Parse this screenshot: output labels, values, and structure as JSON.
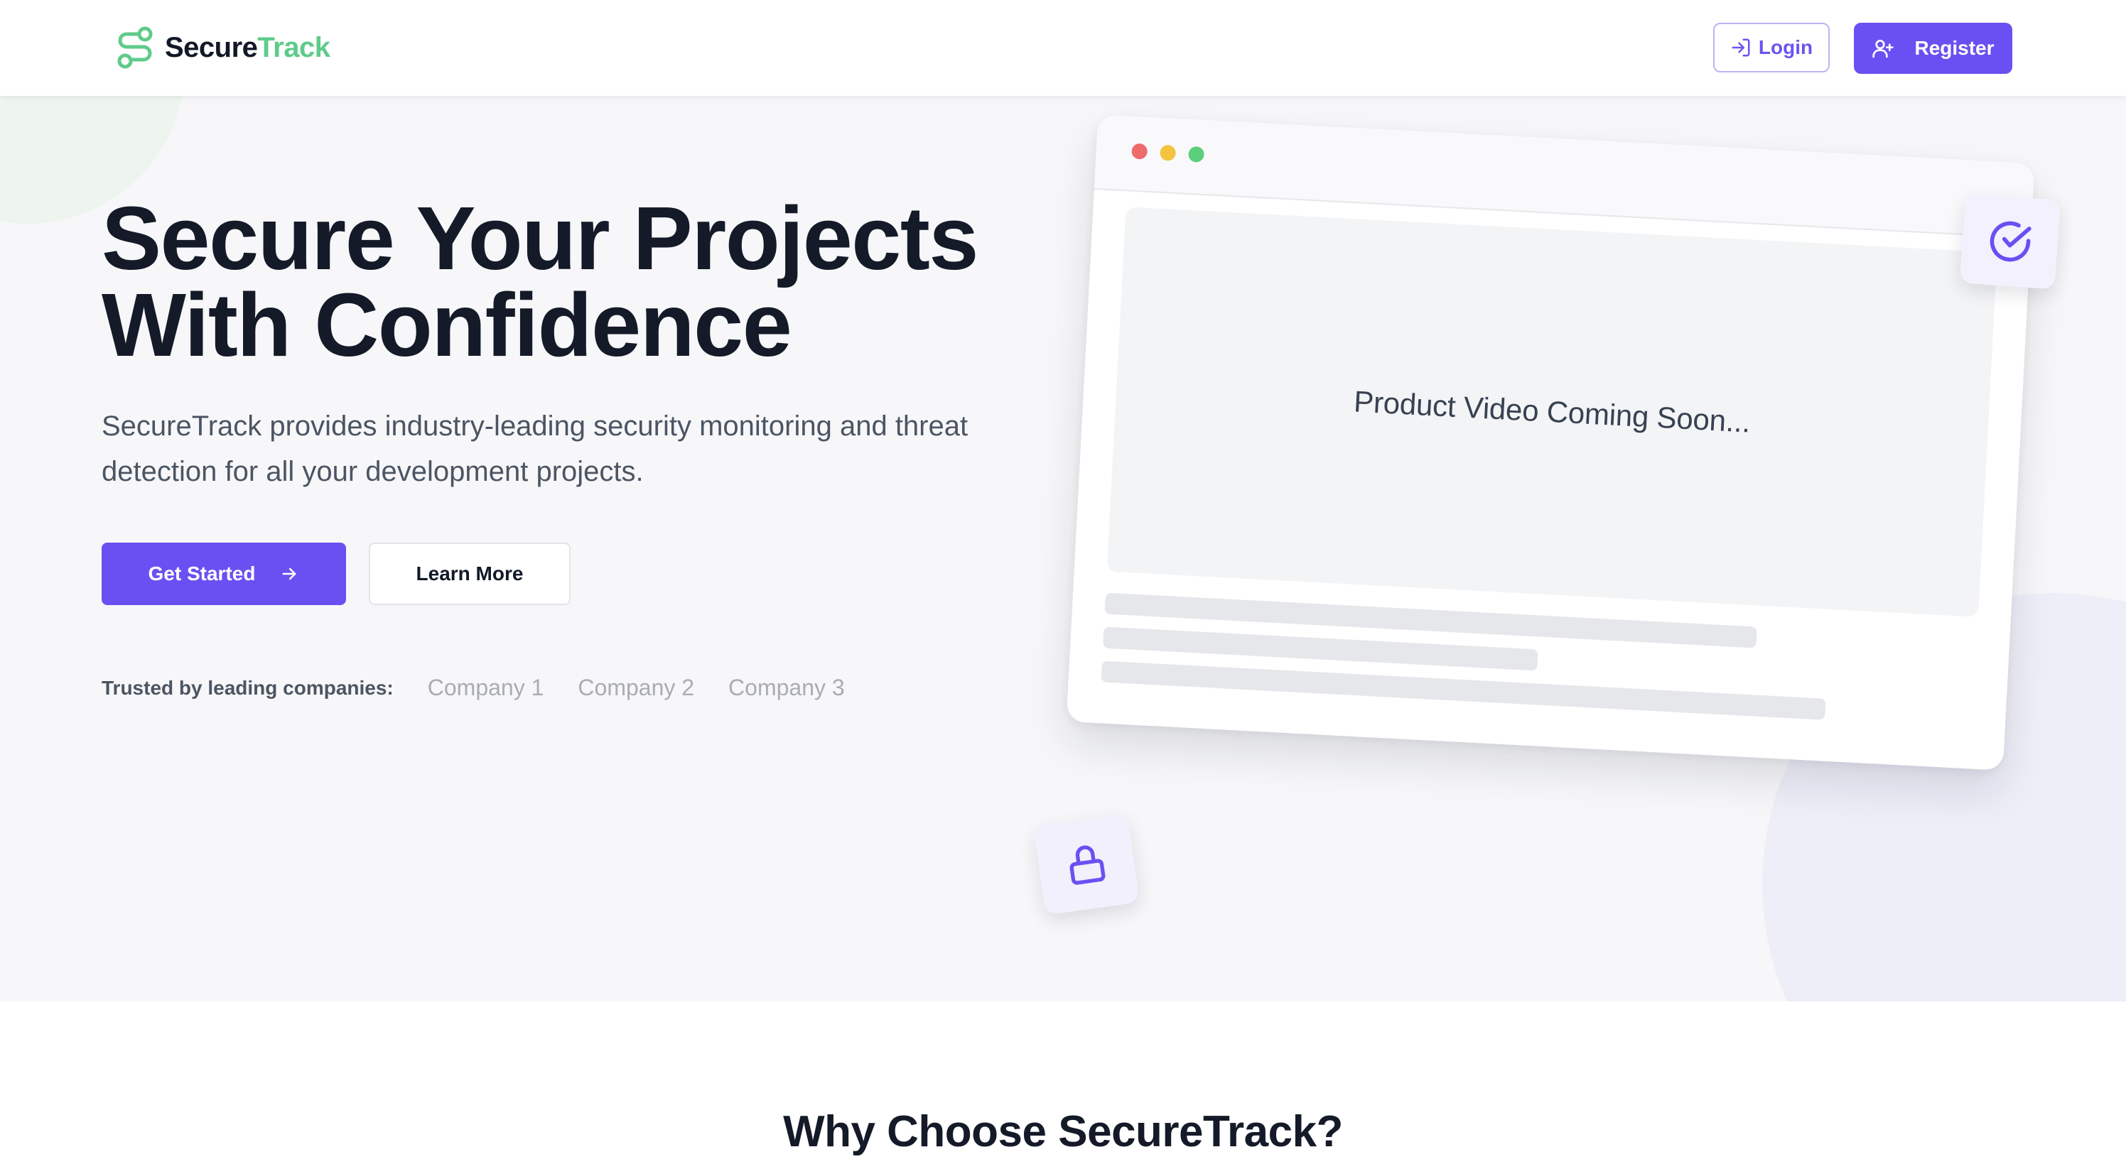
{
  "brand": {
    "name_part1": "Secure",
    "name_part2": "Track",
    "accent_color": "#5fcb8a",
    "icon": "path-route-icon"
  },
  "nav": {
    "login_label": "Login",
    "login_icon": "login-arrow-icon",
    "register_label": "Register",
    "register_icon": "user-plus-icon"
  },
  "hero": {
    "title_line1": "Secure Your Projects",
    "title_line2": "With Confidence",
    "subtitle": "SecureTrack provides industry-leading security monitoring and threat detection for all your development projects.",
    "cta_primary": "Get Started",
    "cta_primary_icon": "arrow-right-icon",
    "cta_secondary": "Learn More",
    "trusted_label": "Trusted by leading companies:",
    "companies": [
      "Company 1",
      "Company 2",
      "Company 3"
    ]
  },
  "mockup": {
    "video_placeholder": "Product Video Coming Soon...",
    "window_dots": [
      "#ef6b6b",
      "#f4c441",
      "#5bcf7a"
    ],
    "badges": [
      "check-circle-icon",
      "lock-icon"
    ]
  },
  "features": {
    "title": "Why Choose SecureTrack?"
  },
  "colors": {
    "primary": "#6a50f2",
    "heading": "#141a28",
    "body_text": "#4b5563",
    "muted": "#a9acb4"
  }
}
